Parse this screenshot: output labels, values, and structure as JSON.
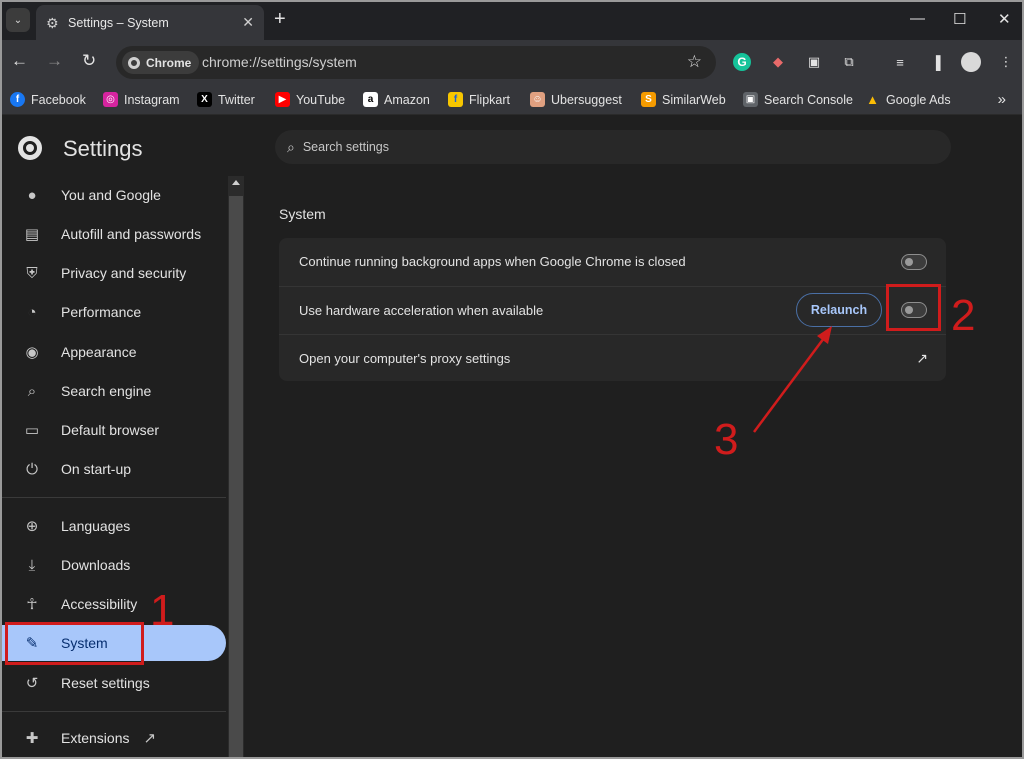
{
  "tab": {
    "title": "Settings – System",
    "close": "✕"
  },
  "tabstrip": {
    "new_tab": "+",
    "minimize": "—",
    "maximize": "☐",
    "close": "✕",
    "search_tabs": "⌄"
  },
  "toolbar": {
    "back": "←",
    "forward": "→",
    "reload": "↻",
    "chip_label": "Chrome",
    "url": "chrome://settings/system",
    "star": "☆",
    "extensions": [
      "grammarly-icon",
      "tag-icon",
      "media-icon",
      "puzzle-icon"
    ],
    "grammarly_letter": "G",
    "reading_list": "≡",
    "side_panel": "▐",
    "menu": "⋮"
  },
  "bookmarks": [
    {
      "label": "Facebook",
      "color": "#1877f2",
      "glyph": "f"
    },
    {
      "label": "Instagram",
      "color": "#d6249f",
      "glyph": "◎"
    },
    {
      "label": "Twitter",
      "color": "#000000",
      "glyph": "X"
    },
    {
      "label": "YouTube",
      "color": "#ff0000",
      "glyph": "▶"
    },
    {
      "label": "Amazon",
      "color": "#ffffff",
      "glyph": "a"
    },
    {
      "label": "Flipkart",
      "color": "#f7c600",
      "glyph": "f"
    },
    {
      "label": "Ubersuggest",
      "color": "#e0a080",
      "glyph": "☺"
    },
    {
      "label": "SimilarWeb",
      "color": "#f59b00",
      "glyph": "S"
    },
    {
      "label": "Search Console",
      "color": "#8ab4f8",
      "glyph": "▣"
    },
    {
      "label": "Google Ads",
      "color": "#4285f4",
      "glyph": "▲"
    }
  ],
  "bookmarks_more": "»",
  "sidebar": {
    "title": "Settings",
    "items": [
      {
        "label": "You and Google",
        "icon": "person-icon",
        "glyph": "👤"
      },
      {
        "label": "Autofill and passwords",
        "icon": "clipboard-icon",
        "glyph": "📋"
      },
      {
        "label": "Privacy and security",
        "icon": "shield-icon",
        "glyph": "⛨"
      },
      {
        "label": "Performance",
        "icon": "gauge-icon",
        "glyph": "◔"
      },
      {
        "label": "Appearance",
        "icon": "palette-icon",
        "glyph": "🎨"
      },
      {
        "label": "Search engine",
        "icon": "search-icon",
        "glyph": "⌕"
      },
      {
        "label": "Default browser",
        "icon": "browser-icon",
        "glyph": "▭"
      },
      {
        "label": "On start-up",
        "icon": "power-icon",
        "glyph": "⏻"
      },
      {
        "label": "Languages",
        "icon": "globe-icon",
        "glyph": "🌐"
      },
      {
        "label": "Downloads",
        "icon": "download-icon",
        "glyph": "⤓"
      },
      {
        "label": "Accessibility",
        "icon": "accessibility-icon",
        "glyph": "☥"
      },
      {
        "label": "System",
        "icon": "wrench-icon",
        "glyph": "🔧",
        "active": true
      },
      {
        "label": "Reset settings",
        "icon": "history-icon",
        "glyph": "↺"
      },
      {
        "label": "Extensions",
        "icon": "puzzle-icon",
        "glyph": "✚"
      }
    ],
    "extensions_external": "↗"
  },
  "main": {
    "search_placeholder": "Search settings",
    "section_title": "System",
    "rows": [
      {
        "label": "Continue running background apps when Google Chrome is closed",
        "toggle_on": false
      },
      {
        "label": "Use hardware acceleration when available",
        "toggle_on": false,
        "button": "Relaunch"
      },
      {
        "label": "Open your computer's proxy settings",
        "external": "↗"
      }
    ]
  },
  "annotations": {
    "one": "1",
    "two": "2",
    "three": "3",
    "color": "#d01c1c"
  }
}
